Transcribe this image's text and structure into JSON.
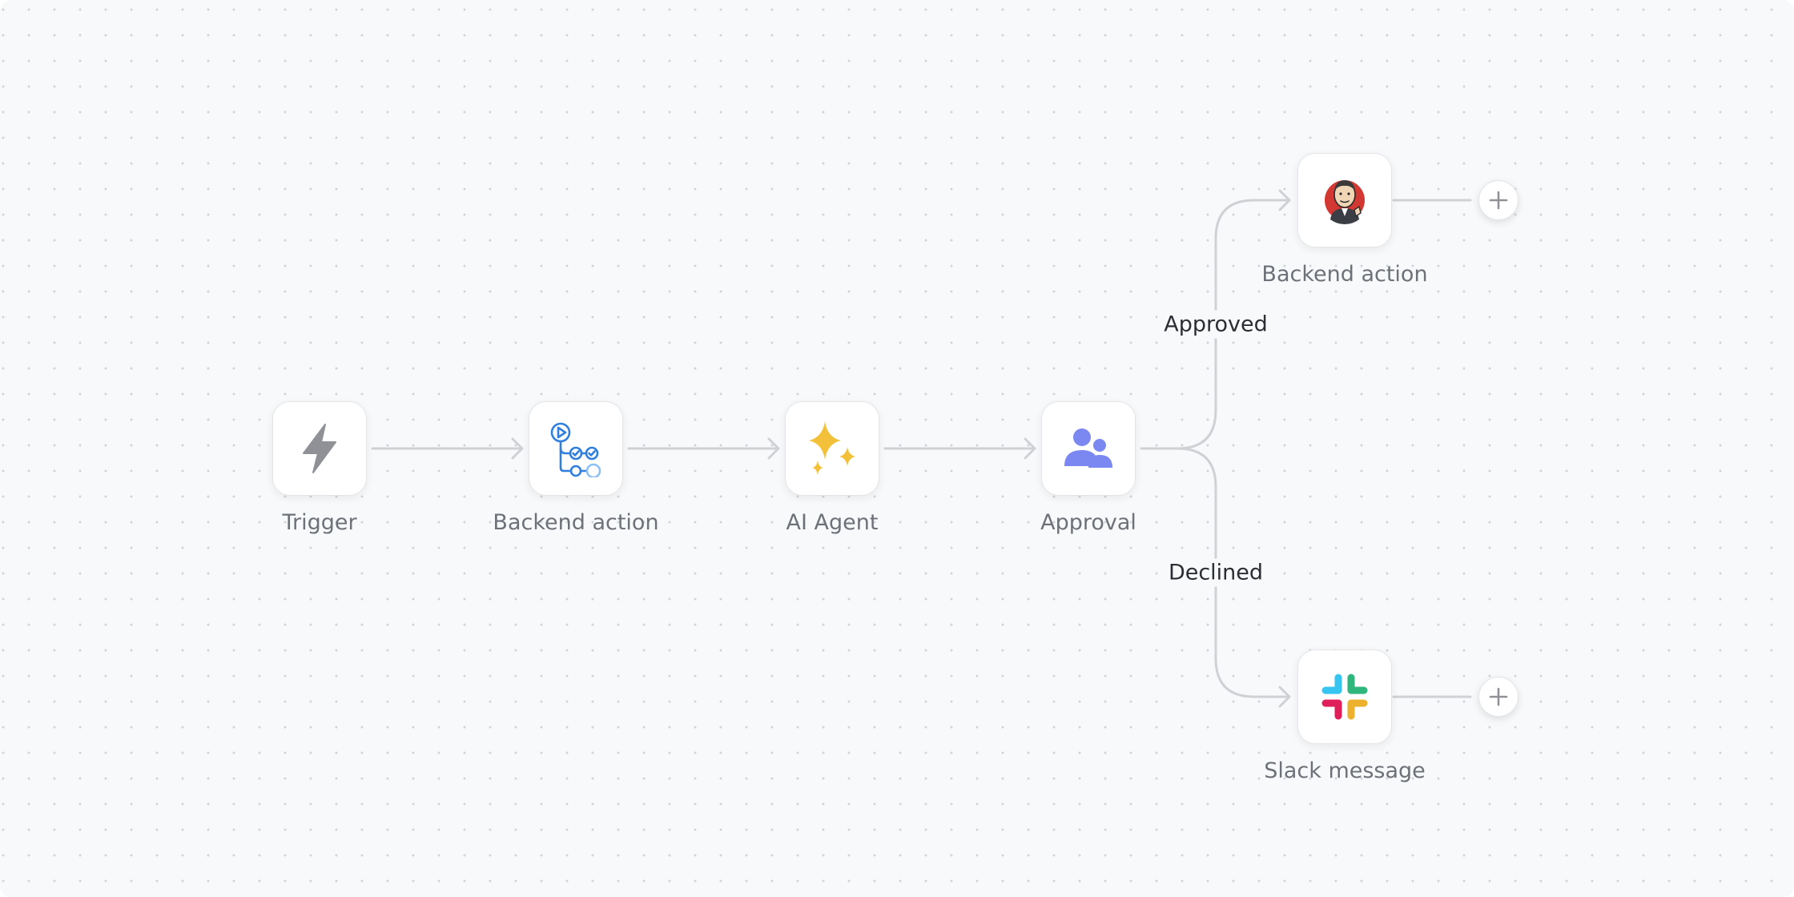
{
  "workflow": {
    "nodes": [
      {
        "id": "trigger",
        "label": "Trigger",
        "icon": "lightning-icon"
      },
      {
        "id": "backend-github",
        "label": "Backend action",
        "icon": "github-actions-icon"
      },
      {
        "id": "ai-agent",
        "label": "AI Agent",
        "icon": "sparkles-icon"
      },
      {
        "id": "approval",
        "label": "Approval",
        "icon": "users-icon"
      },
      {
        "id": "backend-jenkins",
        "label": "Backend action",
        "icon": "jenkins-icon"
      },
      {
        "id": "slack",
        "label": "Slack message",
        "icon": "slack-icon"
      }
    ],
    "branches": {
      "approved": "Approved",
      "declined": "Declined"
    },
    "add_button_symbol": "+"
  },
  "colors": {
    "edge": "#cfd1d5",
    "lightning": "#8f9196",
    "github_blue": "#2f7fde",
    "sparkle": "#f3c039",
    "approval": "#7c88f2",
    "slack_blue": "#36c5f0",
    "slack_green": "#2eb67d",
    "slack_yellow": "#ecb22e",
    "slack_red": "#e01e5a",
    "jenkins_red": "#d33833"
  }
}
